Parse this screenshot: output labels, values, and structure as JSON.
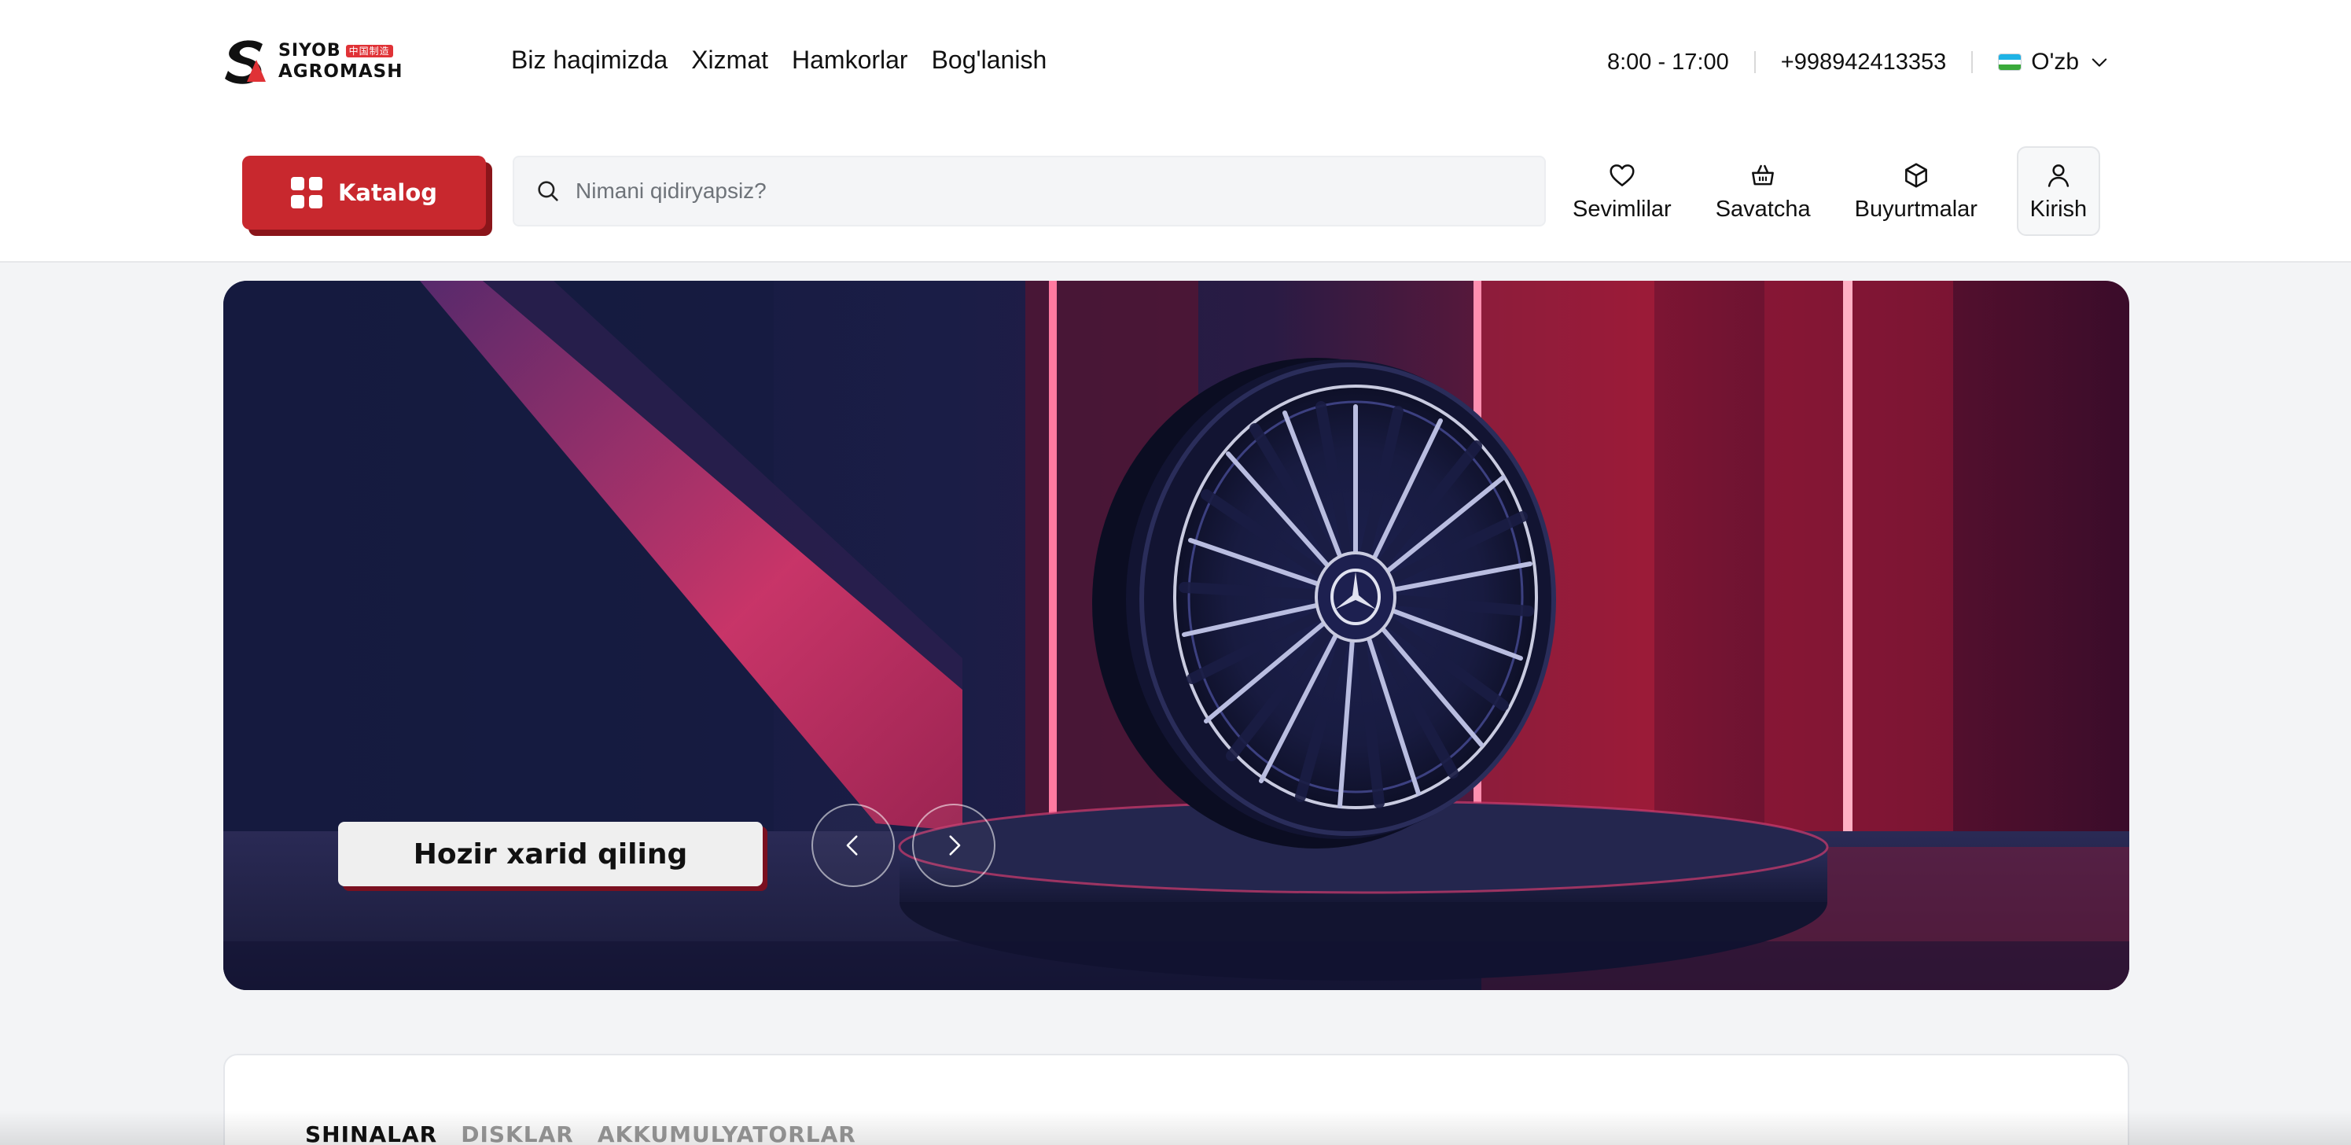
{
  "brand": {
    "name": "SIYOB",
    "badge": "中国制造",
    "sub": "AGROMASH"
  },
  "nav": {
    "items": [
      "Biz haqimizda",
      "Xizmat",
      "Hamkorlar",
      "Bog'lanish"
    ]
  },
  "contacts": {
    "hours": "8:00 - 17:00",
    "phone": "+998942413353",
    "language": "O'zb"
  },
  "toolbar": {
    "catalog_label": "Katalog",
    "search_placeholder": "Nimani qidiryapsiz?",
    "favorites_label": "Sevimlilar",
    "cart_label": "Savatcha",
    "orders_label": "Buyurtmalar",
    "login_label": "Kirish"
  },
  "hero": {
    "cta_label": "Hozir xarid qiling",
    "icons": [
      "chevron-left-icon",
      "chevron-right-icon"
    ]
  },
  "tabs": {
    "items": [
      "SHINALAR",
      "DISKLAR",
      "AKKUMULYATORLAR"
    ],
    "active": "SHINALAR"
  },
  "colors": {
    "accent": "#c8282e",
    "accent_shadow": "#8a151a",
    "page_bg": "#f3f4f6"
  }
}
